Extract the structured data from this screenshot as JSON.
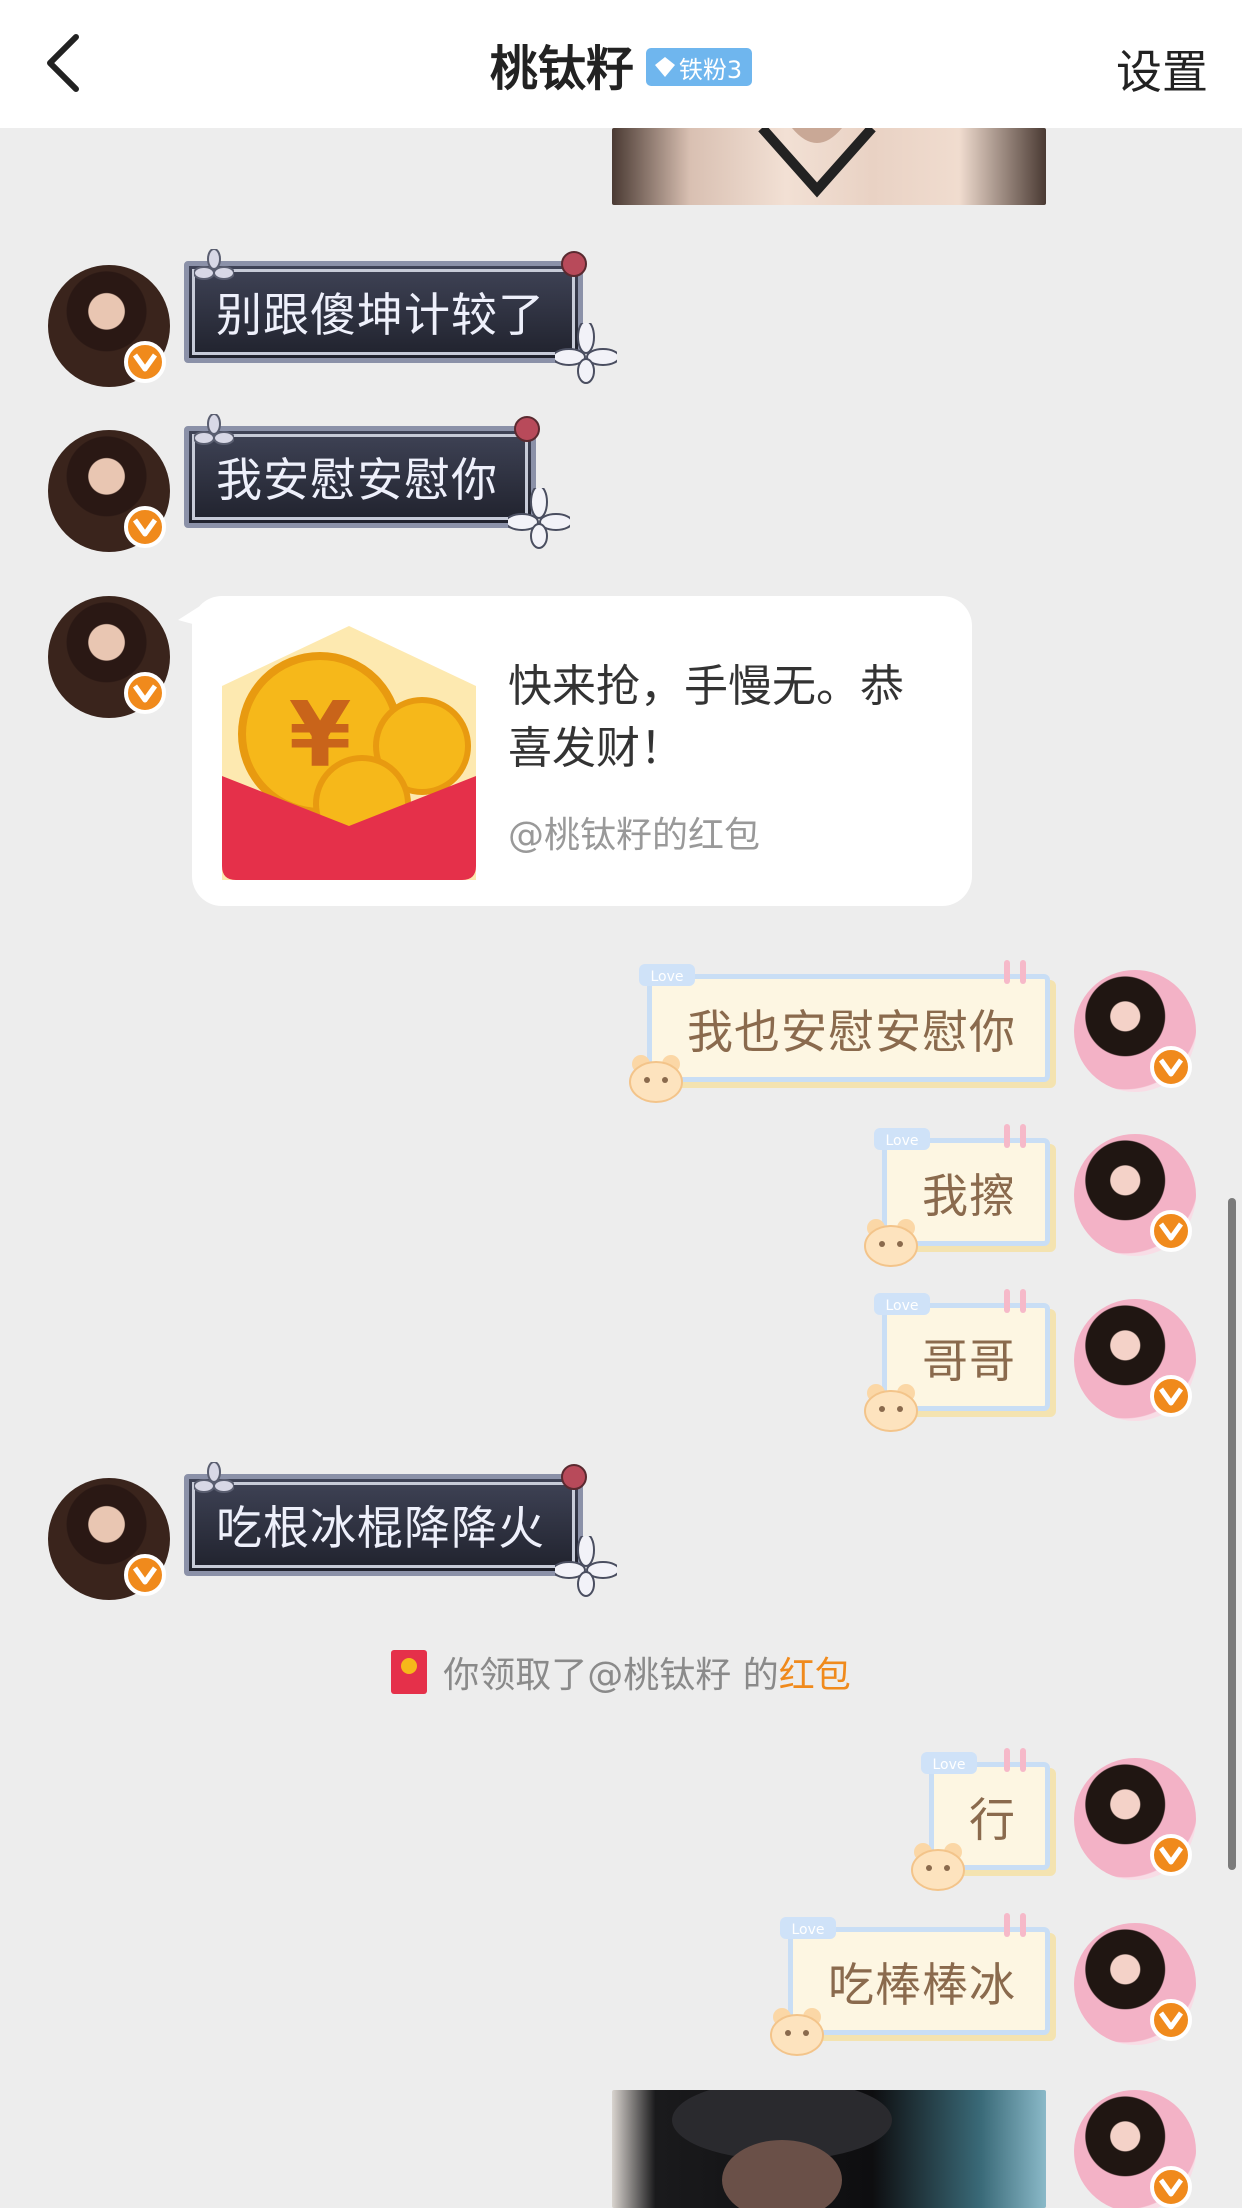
{
  "header": {
    "title": "桃钛籽",
    "fan_badge": "铁粉3",
    "settings_label": "设置"
  },
  "messages": {
    "m1": "别跟傻坤计较了",
    "m2": "我安慰安慰你",
    "red_packet": {
      "text": "快来抢，手慢无。恭喜发财！",
      "sub": "@桃钛籽的红包"
    },
    "m3": "我也安慰安慰你",
    "m4": "我擦",
    "m5": "哥哥",
    "m6": "吃根冰棍降降火",
    "m7": "行",
    "m8": "吃棒棒冰"
  },
  "system": {
    "prefix": "你领取了@桃钛籽 的",
    "highlight": "红包"
  },
  "colors": {
    "accent": "#f08a1c",
    "red_packet": "#e5304a",
    "fan_badge": "#6fb6ee"
  }
}
